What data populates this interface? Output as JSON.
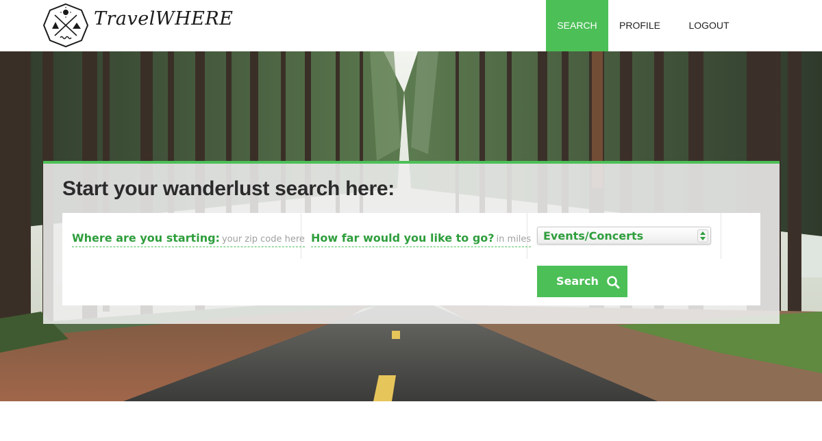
{
  "header": {
    "brand": "TravelWHERE",
    "logo_icon": "compass-badge-icon",
    "nav": {
      "search": "SEARCH",
      "profile": "PROFILE",
      "logout": "LOGOUT"
    },
    "active_item": "search"
  },
  "hero": {
    "background": "forest-road-photo"
  },
  "search_panel": {
    "title": "Start your wanderlust search here:",
    "start_label": "Where are you starting:",
    "start_placeholder": "your zip code here",
    "distance_label": "How far would you like to go?",
    "distance_placeholder": "in miles",
    "category_selected": "Events/Concerts",
    "search_button": "Search",
    "search_icon": "magnifier-icon"
  },
  "colors": {
    "accent": "#4cbf57",
    "accent_text": "#2e9e3c",
    "panel": "#eeeeee",
    "text": "#2b2b2b"
  }
}
